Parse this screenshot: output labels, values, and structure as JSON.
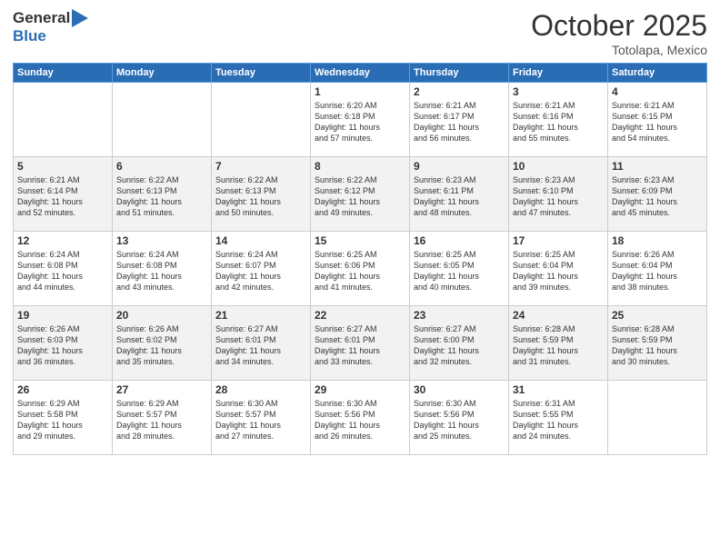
{
  "header": {
    "logo_general": "General",
    "logo_blue": "Blue",
    "month": "October 2025",
    "location": "Totolapa, Mexico"
  },
  "weekdays": [
    "Sunday",
    "Monday",
    "Tuesday",
    "Wednesday",
    "Thursday",
    "Friday",
    "Saturday"
  ],
  "weeks": [
    [
      {
        "day": "",
        "info": ""
      },
      {
        "day": "",
        "info": ""
      },
      {
        "day": "",
        "info": ""
      },
      {
        "day": "1",
        "info": "Sunrise: 6:20 AM\nSunset: 6:18 PM\nDaylight: 11 hours\nand 57 minutes."
      },
      {
        "day": "2",
        "info": "Sunrise: 6:21 AM\nSunset: 6:17 PM\nDaylight: 11 hours\nand 56 minutes."
      },
      {
        "day": "3",
        "info": "Sunrise: 6:21 AM\nSunset: 6:16 PM\nDaylight: 11 hours\nand 55 minutes."
      },
      {
        "day": "4",
        "info": "Sunrise: 6:21 AM\nSunset: 6:15 PM\nDaylight: 11 hours\nand 54 minutes."
      }
    ],
    [
      {
        "day": "5",
        "info": "Sunrise: 6:21 AM\nSunset: 6:14 PM\nDaylight: 11 hours\nand 52 minutes."
      },
      {
        "day": "6",
        "info": "Sunrise: 6:22 AM\nSunset: 6:13 PM\nDaylight: 11 hours\nand 51 minutes."
      },
      {
        "day": "7",
        "info": "Sunrise: 6:22 AM\nSunset: 6:13 PM\nDaylight: 11 hours\nand 50 minutes."
      },
      {
        "day": "8",
        "info": "Sunrise: 6:22 AM\nSunset: 6:12 PM\nDaylight: 11 hours\nand 49 minutes."
      },
      {
        "day": "9",
        "info": "Sunrise: 6:23 AM\nSunset: 6:11 PM\nDaylight: 11 hours\nand 48 minutes."
      },
      {
        "day": "10",
        "info": "Sunrise: 6:23 AM\nSunset: 6:10 PM\nDaylight: 11 hours\nand 47 minutes."
      },
      {
        "day": "11",
        "info": "Sunrise: 6:23 AM\nSunset: 6:09 PM\nDaylight: 11 hours\nand 45 minutes."
      }
    ],
    [
      {
        "day": "12",
        "info": "Sunrise: 6:24 AM\nSunset: 6:08 PM\nDaylight: 11 hours\nand 44 minutes."
      },
      {
        "day": "13",
        "info": "Sunrise: 6:24 AM\nSunset: 6:08 PM\nDaylight: 11 hours\nand 43 minutes."
      },
      {
        "day": "14",
        "info": "Sunrise: 6:24 AM\nSunset: 6:07 PM\nDaylight: 11 hours\nand 42 minutes."
      },
      {
        "day": "15",
        "info": "Sunrise: 6:25 AM\nSunset: 6:06 PM\nDaylight: 11 hours\nand 41 minutes."
      },
      {
        "day": "16",
        "info": "Sunrise: 6:25 AM\nSunset: 6:05 PM\nDaylight: 11 hours\nand 40 minutes."
      },
      {
        "day": "17",
        "info": "Sunrise: 6:25 AM\nSunset: 6:04 PM\nDaylight: 11 hours\nand 39 minutes."
      },
      {
        "day": "18",
        "info": "Sunrise: 6:26 AM\nSunset: 6:04 PM\nDaylight: 11 hours\nand 38 minutes."
      }
    ],
    [
      {
        "day": "19",
        "info": "Sunrise: 6:26 AM\nSunset: 6:03 PM\nDaylight: 11 hours\nand 36 minutes."
      },
      {
        "day": "20",
        "info": "Sunrise: 6:26 AM\nSunset: 6:02 PM\nDaylight: 11 hours\nand 35 minutes."
      },
      {
        "day": "21",
        "info": "Sunrise: 6:27 AM\nSunset: 6:01 PM\nDaylight: 11 hours\nand 34 minutes."
      },
      {
        "day": "22",
        "info": "Sunrise: 6:27 AM\nSunset: 6:01 PM\nDaylight: 11 hours\nand 33 minutes."
      },
      {
        "day": "23",
        "info": "Sunrise: 6:27 AM\nSunset: 6:00 PM\nDaylight: 11 hours\nand 32 minutes."
      },
      {
        "day": "24",
        "info": "Sunrise: 6:28 AM\nSunset: 5:59 PM\nDaylight: 11 hours\nand 31 minutes."
      },
      {
        "day": "25",
        "info": "Sunrise: 6:28 AM\nSunset: 5:59 PM\nDaylight: 11 hours\nand 30 minutes."
      }
    ],
    [
      {
        "day": "26",
        "info": "Sunrise: 6:29 AM\nSunset: 5:58 PM\nDaylight: 11 hours\nand 29 minutes."
      },
      {
        "day": "27",
        "info": "Sunrise: 6:29 AM\nSunset: 5:57 PM\nDaylight: 11 hours\nand 28 minutes."
      },
      {
        "day": "28",
        "info": "Sunrise: 6:30 AM\nSunset: 5:57 PM\nDaylight: 11 hours\nand 27 minutes."
      },
      {
        "day": "29",
        "info": "Sunrise: 6:30 AM\nSunset: 5:56 PM\nDaylight: 11 hours\nand 26 minutes."
      },
      {
        "day": "30",
        "info": "Sunrise: 6:30 AM\nSunset: 5:56 PM\nDaylight: 11 hours\nand 25 minutes."
      },
      {
        "day": "31",
        "info": "Sunrise: 6:31 AM\nSunset: 5:55 PM\nDaylight: 11 hours\nand 24 minutes."
      },
      {
        "day": "",
        "info": ""
      }
    ]
  ]
}
